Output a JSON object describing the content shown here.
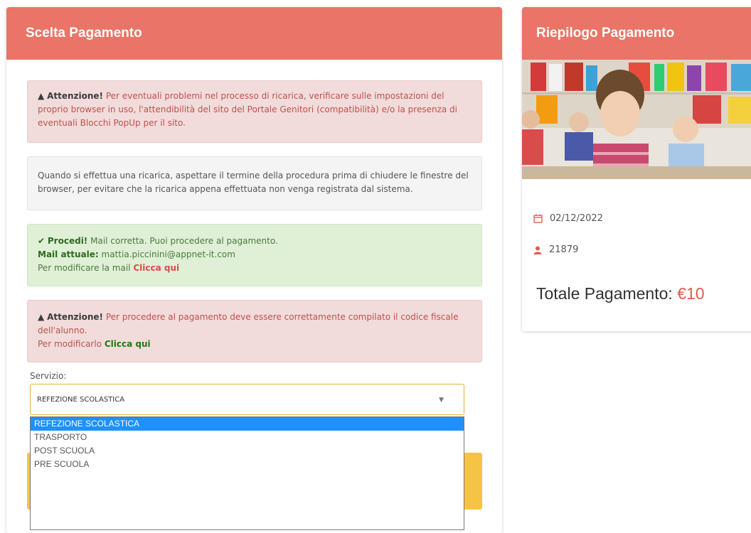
{
  "left_panel": {
    "title": "Scelta Pagamento",
    "alert1": {
      "label": "Attenzione!",
      "text": "Per eventuali problemi nel processo di ricarica, verificare sulle impostazioni del proprio browser in uso, l'attendibilità del sito del Portale Genitori (compatibilità) e/o la presenza di eventuali Blocchi PopUp per il sito."
    },
    "info": {
      "text": "Quando si effettua una ricarica, aspettare il termine della procedura prima di chiudere le finestre del browser, per evitare che la ricarica appena effettuata non venga registrata dal sistema."
    },
    "success": {
      "label": "Procedi!",
      "text": "Mail corretta. Puoi procedere al pagamento.",
      "mail_label": "Mail attuale:",
      "mail_value": "mattia.piccinini@appnet-it.com",
      "modify_text": "Per modificare la mail",
      "modify_link": "Clicca qui"
    },
    "alert2": {
      "label": "Attenzione!",
      "text": "Per procedere al pagamento deve essere correttamente compilato il codice fiscale dell'alunno.",
      "modify_text": "Per modificarlo",
      "modify_link": "Clicca qui"
    },
    "service": {
      "label": "Servizio:",
      "selected": "REFEZIONE SCOLASTICA",
      "options": [
        "REFEZIONE SCOLASTICA",
        "TRASPORTO",
        "POST SCUOLA",
        "PRE SCUOLA"
      ]
    }
  },
  "right_panel": {
    "title": "Riepilogo Pagamento",
    "date": "02/12/2022",
    "user_id": "21879",
    "total_label": "Totale Pagamento:",
    "total_value": "€10"
  },
  "colors": {
    "header": "#e97467",
    "danger_bg": "#f1dcdb",
    "success_bg": "#dff0d7",
    "select_border": "#e9b13d",
    "option_highlight": "#1e90ff",
    "total_amount": "#e25b4f"
  },
  "icons": [
    "warning-icon",
    "check-icon",
    "calendar-icon",
    "user-icon",
    "caret-down-icon"
  ]
}
